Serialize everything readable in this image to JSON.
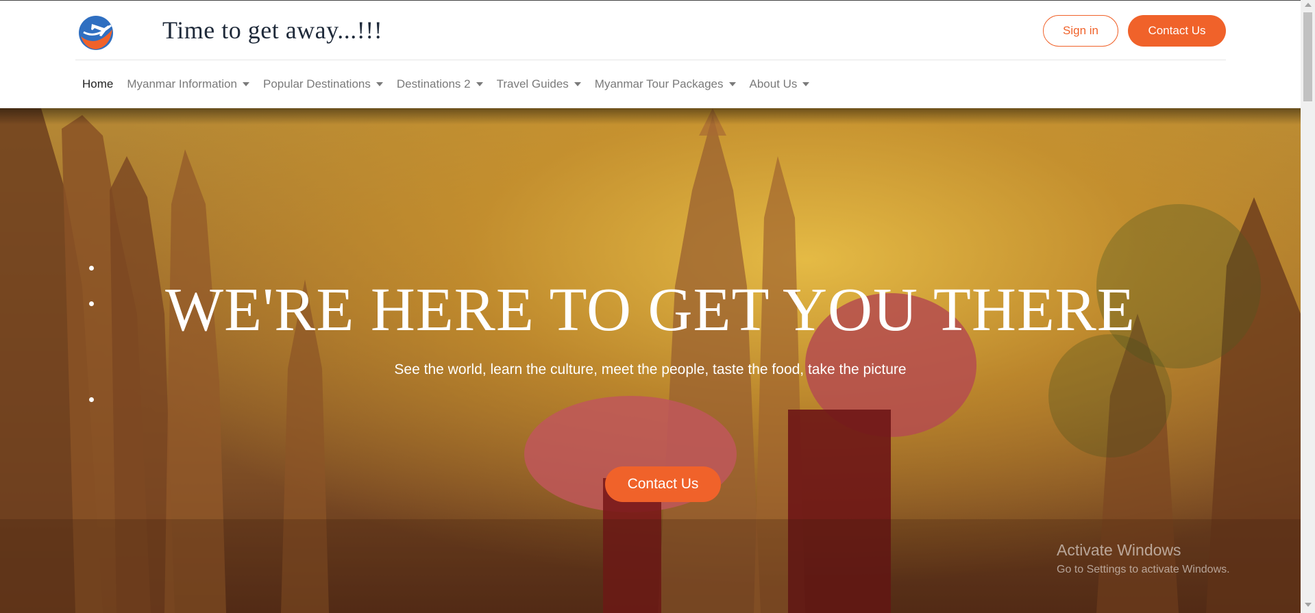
{
  "header": {
    "site_title": "Time to get away...!!!",
    "sign_in_label": "Sign in",
    "contact_label": "Contact Us"
  },
  "nav": {
    "items": [
      {
        "label": "Home",
        "dropdown": false,
        "active": true
      },
      {
        "label": "Myanmar Information",
        "dropdown": true
      },
      {
        "label": "Popular Destinations",
        "dropdown": true
      },
      {
        "label": "Destinations 2",
        "dropdown": true
      },
      {
        "label": "Travel Guides",
        "dropdown": true
      },
      {
        "label": "Myanmar Tour Packages",
        "dropdown": true
      },
      {
        "label": "About Us",
        "dropdown": true
      }
    ]
  },
  "hero": {
    "title": "WE'RE HERE TO GET YOU THERE",
    "subtitle": "See the world, learn the culture, meet the people, taste the food, take the picture",
    "contact_label": "Contact Us"
  },
  "watermark": {
    "title": "Activate Windows",
    "subtitle": "Go to Settings to activate Windows."
  },
  "colors": {
    "accent": "#f0622a",
    "nav_text": "#7a7a7a",
    "active_nav_text": "#222222"
  },
  "icons": [
    "airplane-globe-logo",
    "caret-down-icon",
    "scroll-up-arrow",
    "scroll-down-arrow"
  ]
}
